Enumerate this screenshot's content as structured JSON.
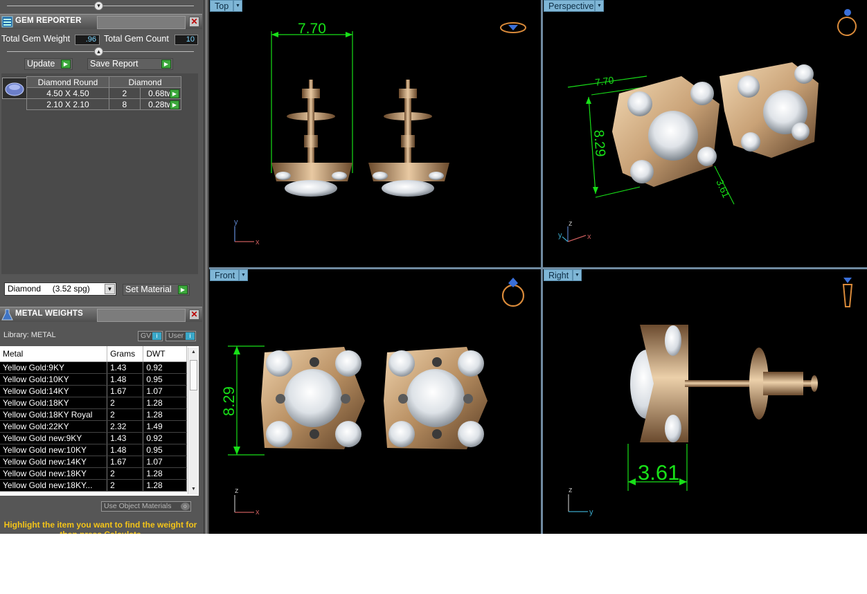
{
  "gem_reporter": {
    "title": "GEM REPORTER",
    "total_weight_label": "Total Gem Weight",
    "total_weight_value": ".96",
    "total_count_label": "Total Gem Count",
    "total_count_value": "10",
    "update_label": "Update",
    "save_report_label": "Save Report",
    "columns": [
      "Diamond Round",
      "Diamond"
    ],
    "rows": [
      {
        "size": "4.50 X 4.50",
        "count": "2",
        "weight": "0.68tw"
      },
      {
        "size": "2.10 X 2.10",
        "count": "8",
        "weight": "0.28tw"
      }
    ],
    "material_select": "Diamond     (3.52 spg)",
    "set_material_label": "Set Material"
  },
  "metal_weights": {
    "title": "METAL WEIGHTS",
    "library_label": "Library: METAL",
    "gv_label": "GV",
    "user_label": "User",
    "columns": [
      "Metal",
      "Grams",
      "DWT"
    ],
    "rows": [
      [
        "Yellow Gold:9KY",
        "1.43",
        "0.92"
      ],
      [
        "Yellow Gold:10KY",
        "1.48",
        "0.95"
      ],
      [
        "Yellow Gold:14KY",
        "1.67",
        "1.07"
      ],
      [
        "Yellow Gold:18KY",
        "2",
        "1.28"
      ],
      [
        "Yellow Gold:18KY Royal",
        "2",
        "1.28"
      ],
      [
        "Yellow Gold:22KY",
        "2.32",
        "1.49"
      ],
      [
        "Yellow Gold new:9KY",
        "1.43",
        "0.92"
      ],
      [
        "Yellow Gold new:10KY",
        "1.48",
        "0.95"
      ],
      [
        "Yellow Gold new:14KY",
        "1.67",
        "1.07"
      ],
      [
        "Yellow Gold new:18KY",
        "2",
        "1.28"
      ],
      [
        "Yellow Gold new:18KY...",
        "2",
        "1.28"
      ]
    ],
    "use_object_materials_label": "Use Object Materials",
    "hint": "Highlight the item you want to find the weight for then press Calculate"
  },
  "viewports": {
    "top": {
      "label": "Top",
      "dimension": "7.70",
      "axis_1": "y",
      "axis_2": "x"
    },
    "perspective": {
      "label": "Perspective",
      "dim_a": "7.70",
      "dim_b": "8.29",
      "dim_c": "3.61",
      "axis_1": "z",
      "axis_2": "y",
      "axis_3": "x"
    },
    "front": {
      "label": "Front",
      "dimension": "8.29",
      "axis_1": "z",
      "axis_2": "x"
    },
    "right": {
      "label": "Right",
      "dimension": "3.61",
      "axis_1": "z",
      "axis_2": "y"
    }
  },
  "colors": {
    "dimension_green": "#18e018",
    "gold": "#c9a277",
    "viewport_tab": "#7fb6d6",
    "hint_yellow": "#f5c518"
  }
}
